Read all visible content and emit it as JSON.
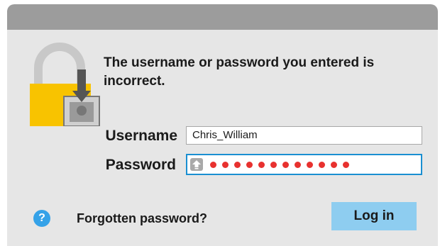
{
  "dialog": {
    "message": "The username or password you entered is incorrect.",
    "lock_icon": "lock-icon",
    "colors": {
      "lock": "#f8c300",
      "accent": "#1a8fd1",
      "button": "#8ecdf0",
      "dots": "#e8312f"
    }
  },
  "fields": {
    "username_label": "Username",
    "username_value": "Chris_William",
    "password_label": "Password",
    "password_mask_count": 12,
    "capslock_icon": "capslock-icon"
  },
  "footer": {
    "help_icon": "help-icon",
    "help_glyph": "?",
    "forgot_label": "Forgotten password?",
    "login_label": "Log in"
  }
}
